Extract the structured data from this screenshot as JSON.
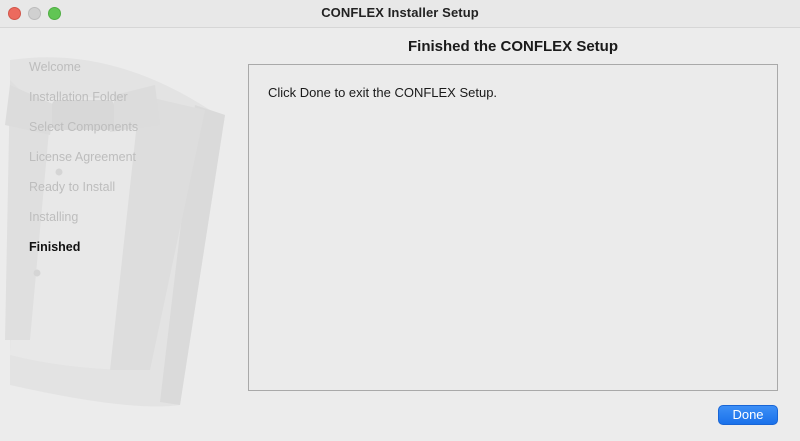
{
  "window": {
    "title": "CONFLEX Installer Setup"
  },
  "sidebar": {
    "steps": [
      {
        "label": "Welcome",
        "state": "done"
      },
      {
        "label": "Installation Folder",
        "state": "done"
      },
      {
        "label": "Select Components",
        "state": "done"
      },
      {
        "label": "License Agreement",
        "state": "done"
      },
      {
        "label": "Ready to Install",
        "state": "done"
      },
      {
        "label": "Installing",
        "state": "done"
      },
      {
        "label": "Finished",
        "state": "current"
      }
    ]
  },
  "main": {
    "heading": "Finished the CONFLEX Setup",
    "message": "Click Done to exit the CONFLEX Setup."
  },
  "footer": {
    "done_label": "Done"
  },
  "colors": {
    "accent": "#1a71ea",
    "close": "#ec6a5e",
    "zoom": "#61c554"
  }
}
